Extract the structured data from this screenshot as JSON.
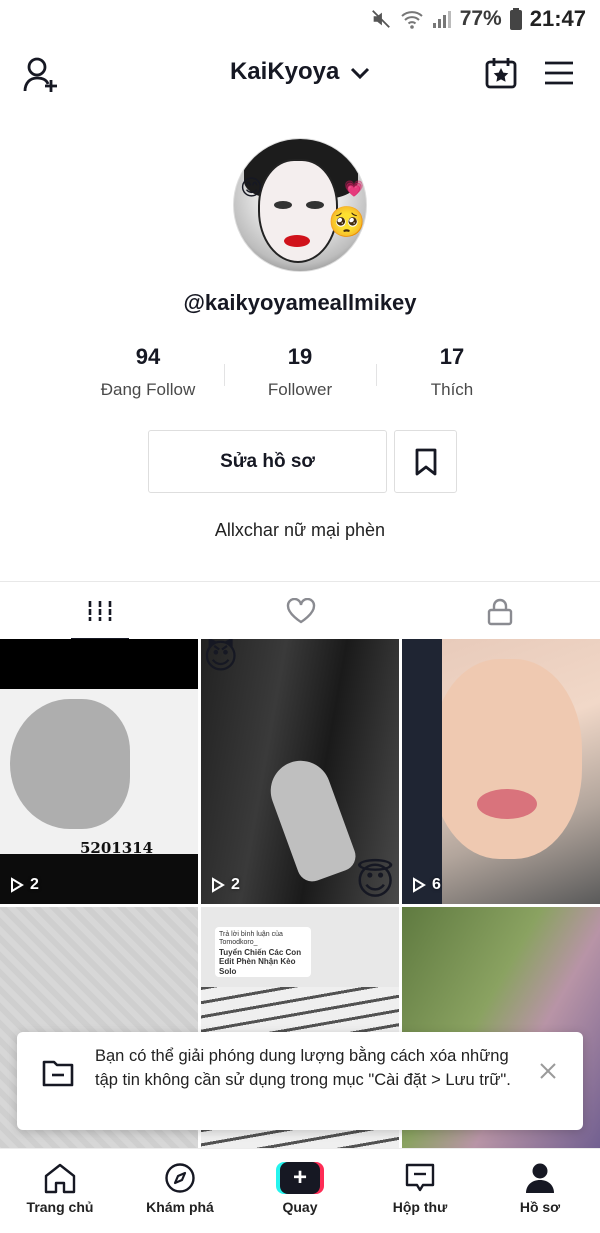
{
  "status_bar": {
    "battery_percent": "77%",
    "time": "21:47",
    "icons": [
      "mute-icon",
      "wifi-icon",
      "signal-icon",
      "battery-icon"
    ]
  },
  "header": {
    "username_title": "KaiKyoya",
    "icons": [
      "add-friend-icon",
      "chevron-down-icon",
      "calendar-star-icon",
      "menu-icon"
    ]
  },
  "profile": {
    "handle": "@kaikyoyameallmikey",
    "bio": "Allxchar nữ mại phèn"
  },
  "stats": [
    {
      "value": "94",
      "label": "Đang Follow"
    },
    {
      "value": "19",
      "label": "Follower"
    },
    {
      "value": "17",
      "label": "Thích"
    }
  ],
  "actions": {
    "edit_profile": "Sửa hồ sơ"
  },
  "tabs": [
    {
      "name": "videos",
      "icon": "grid-icon",
      "active": true
    },
    {
      "name": "liked",
      "icon": "heart-icon",
      "active": false
    },
    {
      "name": "private",
      "icon": "lock-icon",
      "active": false
    }
  ],
  "videos": [
    {
      "views": "2",
      "overlay_text": "5201314"
    },
    {
      "views": "2"
    },
    {
      "views": "6"
    },
    {
      "views": ""
    },
    {
      "views": "",
      "overlay_title": "Tuyển Chiến Các Con Edit Phèn Nhận Kèo Solo",
      "overlay_caption": "Trả lời bình luận của Tomodkoro_"
    },
    {
      "views": ""
    }
  ],
  "toast": {
    "message": "Bạn có thể giải phóng dung lượng bằng cách xóa những tập tin không cần sử dụng trong mục \"Cài đặt > Lưu trữ\"."
  },
  "bottom_nav": [
    {
      "label": "Trang chủ",
      "icon": "home-icon"
    },
    {
      "label": "Khám phá",
      "icon": "compass-icon"
    },
    {
      "label": "Quay",
      "icon": "plus-icon"
    },
    {
      "label": "Hộp thư",
      "icon": "inbox-icon"
    },
    {
      "label": "Hồ sơ",
      "icon": "profile-icon",
      "active": true
    }
  ],
  "colors": {
    "text": "#161823",
    "accent_red": "#fe2c55",
    "accent_cyan": "#25f4ee",
    "border": "#dedede"
  }
}
